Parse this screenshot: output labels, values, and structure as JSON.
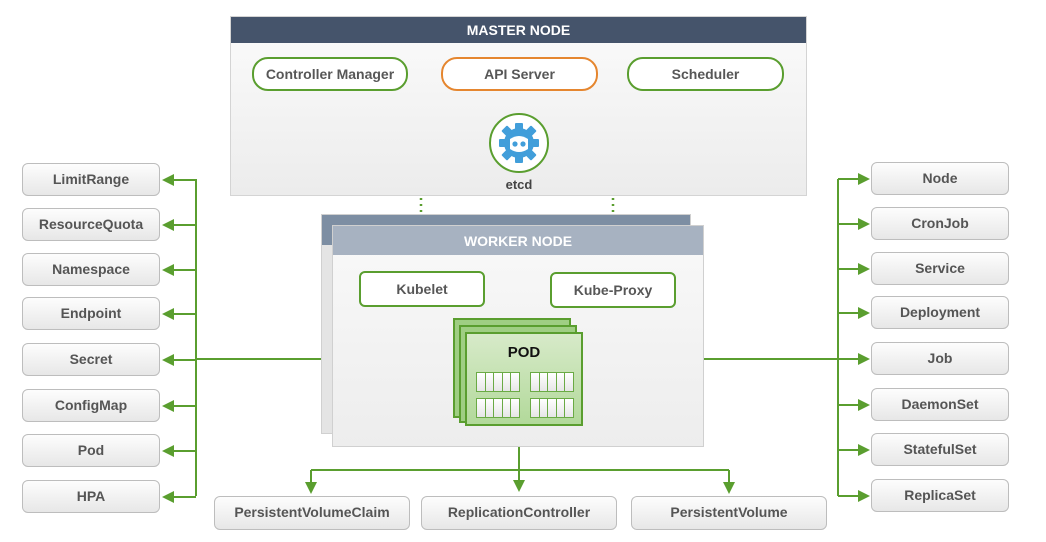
{
  "master_node": {
    "title": "MASTER NODE",
    "components": {
      "controller_manager": "Controller Manager",
      "api_server": "API Server",
      "scheduler": "Scheduler",
      "etcd": "etcd"
    }
  },
  "worker_node": {
    "title": "WORKER NODE",
    "components": {
      "kubelet": "Kubelet",
      "kube_proxy": "Kube-Proxy",
      "pod": "POD"
    }
  },
  "left_resources": [
    "LimitRange",
    "ResourceQuota",
    "Namespace",
    "Endpoint",
    "Secret",
    "ConfigMap",
    "Pod",
    "HPA"
  ],
  "right_resources": [
    "Node",
    "CronJob",
    "Service",
    "Deployment",
    "Job",
    "DaemonSet",
    "StatefulSet",
    "ReplicaSet"
  ],
  "bottom_resources": [
    "PersistentVolumeClaim",
    "ReplicationController",
    "PersistentVolume"
  ],
  "colors": {
    "connector_green": "#5a9e2f",
    "api_server_orange": "#e5862f",
    "master_header": "#45546b",
    "worker_header": "#a7b2c1",
    "etcd_blue": "#419eda"
  }
}
